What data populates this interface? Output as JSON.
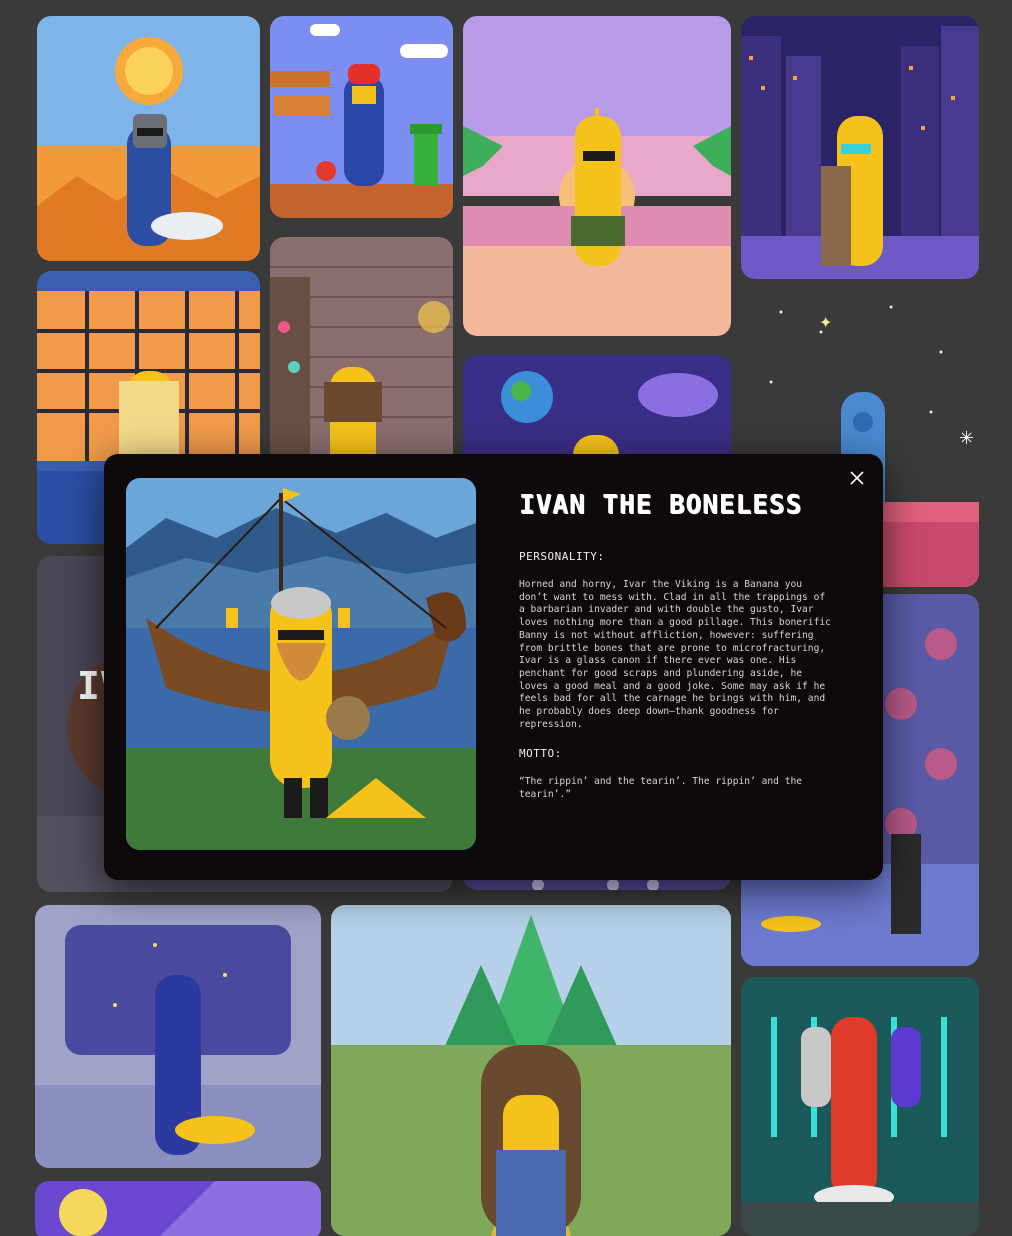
{
  "modal": {
    "title": "IVAN THE BONELESS",
    "personality_label": "PERSONALITY:",
    "personality_text": "Horned and horny, Ivar the Viking is a Banana you don’t want to mess with. Clad in all the trappings of a barbarian invader and with double the gusto, Ivar loves nothing more than a good pillage. This bonerific Banny is not without affliction, however: suffering from brittle bones that are prone to microfracturing, Ivar is a glass canon if there ever was one. His penchant for good scraps and plundering aside, he loves a good meal and a good joke. Some may ask if he feels bad for all the carnage he brings with him, and he probably does deep down—thank goodness for repression.",
    "motto_label": "MOTTO:",
    "motto_text": "“The rippin’ and the tearin’. The rippin’ and the tearin’.”",
    "close_icon": "close-icon"
  },
  "background_partial_text": "IV",
  "colors": {
    "page_bg": "#3b3a3b",
    "modal_bg": "#0e0a0c",
    "banana": "#f5c21b"
  },
  "gallery": [
    {
      "name": "tile-desert-knight"
    },
    {
      "name": "tile-mario-world"
    },
    {
      "name": "tile-sunset-beach"
    },
    {
      "name": "tile-cyber-city"
    },
    {
      "name": "tile-japanese-room"
    },
    {
      "name": "tile-alchemy-lab"
    },
    {
      "name": "tile-space-planet"
    },
    {
      "name": "tile-alien-space"
    },
    {
      "name": "tile-viking-ship"
    },
    {
      "name": "tile-disco-room"
    },
    {
      "name": "tile-starship-bridge"
    },
    {
      "name": "tile-emerald-city"
    },
    {
      "name": "tile-cryo-lab"
    },
    {
      "name": "tile-purple-shop"
    }
  ]
}
